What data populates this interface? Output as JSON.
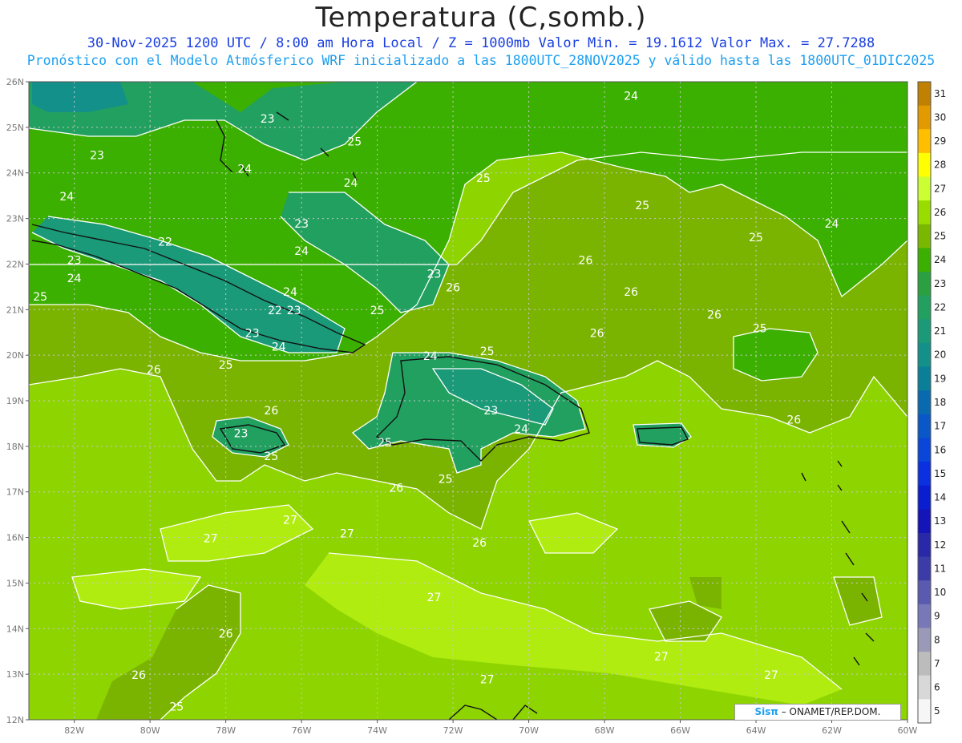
{
  "header": {
    "title": "Temperatura (C,somb.)",
    "subtitle1": "30-Nov-2025  1200 UTC / 8:00 am Hora Local / Z = 1000mb   Valor Min. = 19.1612  Valor Max. = 27.7288",
    "subtitle2": "Pronóstico con el Modelo Atmósferico WRF inicializado a las 1800UTC_28NOV2025 y válido hasta las  1800UTC_01DIC2025"
  },
  "map": {
    "lat_labels": [
      "26N",
      "25N",
      "24N",
      "23N",
      "22N",
      "21N",
      "20N",
      "19N",
      "18N",
      "17N",
      "16N",
      "15N",
      "14N",
      "13N",
      "12N"
    ],
    "lon_labels": [
      "82W",
      "80W",
      "78W",
      "76W",
      "74W",
      "72W",
      "70W",
      "68W",
      "66W",
      "64W",
      "62W",
      "60W"
    ],
    "lat_range": [
      12,
      26
    ],
    "lon_range": [
      -83.2,
      -60
    ],
    "grid": "dotted",
    "contour_labels": [
      {
        "text": "24",
        "lon": -67.3,
        "lat": 25.6
      },
      {
        "text": "23",
        "lon": -76.9,
        "lat": 25.1
      },
      {
        "text": "23",
        "lon": -81.4,
        "lat": 24.3
      },
      {
        "text": "24",
        "lon": -77.5,
        "lat": 24.0
      },
      {
        "text": "25",
        "lon": -74.6,
        "lat": 24.6
      },
      {
        "text": "25",
        "lon": -71.2,
        "lat": 23.8
      },
      {
        "text": "24",
        "lon": -74.7,
        "lat": 23.7
      },
      {
        "text": "24",
        "lon": -82.2,
        "lat": 23.4
      },
      {
        "text": "25",
        "lon": -67.0,
        "lat": 23.2
      },
      {
        "text": "25",
        "lon": -64.0,
        "lat": 22.5
      },
      {
        "text": "24",
        "lon": -62.0,
        "lat": 22.8
      },
      {
        "text": "23",
        "lon": -76.0,
        "lat": 22.8
      },
      {
        "text": "22",
        "lon": -79.6,
        "lat": 22.4
      },
      {
        "text": "24",
        "lon": -76.0,
        "lat": 22.2
      },
      {
        "text": "23",
        "lon": -82.0,
        "lat": 22.0
      },
      {
        "text": "26",
        "lon": -68.5,
        "lat": 22.0
      },
      {
        "text": "24",
        "lon": -82.0,
        "lat": 21.6
      },
      {
        "text": "24",
        "lon": -76.3,
        "lat": 21.3
      },
      {
        "text": "23",
        "lon": -72.5,
        "lat": 21.7
      },
      {
        "text": "26",
        "lon": -72.0,
        "lat": 21.4
      },
      {
        "text": "26",
        "lon": -67.3,
        "lat": 21.3
      },
      {
        "text": "25",
        "lon": -82.9,
        "lat": 21.2
      },
      {
        "text": "22",
        "lon": -76.7,
        "lat": 20.9
      },
      {
        "text": "23",
        "lon": -76.2,
        "lat": 20.9
      },
      {
        "text": "25",
        "lon": -74.0,
        "lat": 20.9
      },
      {
        "text": "26",
        "lon": -65.1,
        "lat": 20.8
      },
      {
        "text": "26",
        "lon": -68.2,
        "lat": 20.4
      },
      {
        "text": "25",
        "lon": -63.9,
        "lat": 20.5
      },
      {
        "text": "23",
        "lon": -77.3,
        "lat": 20.4
      },
      {
        "text": "24",
        "lon": -76.6,
        "lat": 20.1
      },
      {
        "text": "24",
        "lon": -72.6,
        "lat": 19.9
      },
      {
        "text": "25",
        "lon": -71.1,
        "lat": 20.0
      },
      {
        "text": "25",
        "lon": -78.0,
        "lat": 19.7
      },
      {
        "text": "26",
        "lon": -79.9,
        "lat": 19.6
      },
      {
        "text": "26",
        "lon": -76.8,
        "lat": 18.7
      },
      {
        "text": "23",
        "lon": -71.0,
        "lat": 18.7
      },
      {
        "text": "26",
        "lon": -63.0,
        "lat": 18.5
      },
      {
        "text": "23",
        "lon": -77.6,
        "lat": 18.2
      },
      {
        "text": "24",
        "lon": -70.2,
        "lat": 18.3
      },
      {
        "text": "25",
        "lon": -73.8,
        "lat": 18.0
      },
      {
        "text": "25",
        "lon": -76.8,
        "lat": 17.7
      },
      {
        "text": "25",
        "lon": -72.2,
        "lat": 17.2
      },
      {
        "text": "26",
        "lon": -73.5,
        "lat": 17.0
      },
      {
        "text": "27",
        "lon": -76.3,
        "lat": 16.3
      },
      {
        "text": "27",
        "lon": -78.4,
        "lat": 15.9
      },
      {
        "text": "27",
        "lon": -74.8,
        "lat": 16.0
      },
      {
        "text": "26",
        "lon": -71.3,
        "lat": 15.8
      },
      {
        "text": "27",
        "lon": -72.5,
        "lat": 14.6
      },
      {
        "text": "26",
        "lon": -78.0,
        "lat": 13.8
      },
      {
        "text": "27",
        "lon": -66.5,
        "lat": 13.3
      },
      {
        "text": "27",
        "lon": -63.6,
        "lat": 12.9
      },
      {
        "text": "26",
        "lon": -80.3,
        "lat": 12.9
      },
      {
        "text": "27",
        "lon": -71.1,
        "lat": 12.8
      },
      {
        "text": "25",
        "lon": -79.3,
        "lat": 12.2
      }
    ]
  },
  "colorbar": {
    "labels": [
      "31",
      "30",
      "29",
      "28",
      "27",
      "26",
      "25",
      "24",
      "23",
      "22",
      "21",
      "20",
      "19",
      "18",
      "17",
      "16",
      "15",
      "14",
      "13",
      "12",
      "11",
      "10",
      "9",
      "8",
      "7",
      "6",
      "5"
    ],
    "colors": [
      "#c08000",
      "#e39a00",
      "#ffbf00",
      "#ffff00",
      "#ccff33",
      "#99dd00",
      "#7ab800",
      "#3cb000",
      "#2aa040",
      "#22a060",
      "#1a9a78",
      "#14908a",
      "#0a8098",
      "#0a6ab0",
      "#0a58c8",
      "#0a46d8",
      "#0a30e0",
      "#0a1ed0",
      "#1414b8",
      "#2828a8",
      "#3c3ca8",
      "#5a5ab0",
      "#7878b8",
      "#9a9ab8",
      "#bcbcbc",
      "#d8d8d8",
      "#f6f6f6"
    ]
  },
  "credit": {
    "logo": "Sisπ",
    "text": " – ONAMET/REP.DOM."
  }
}
